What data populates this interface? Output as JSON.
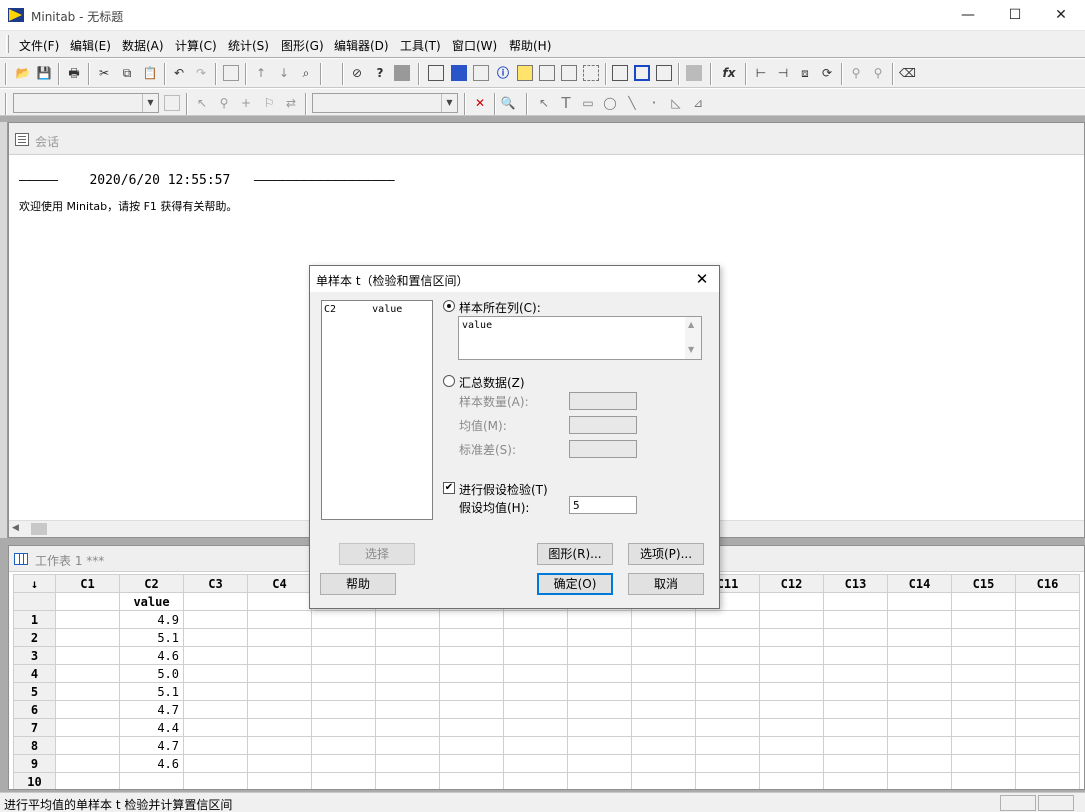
{
  "app": {
    "title": "Minitab - 无标题"
  },
  "window_controls": {
    "minimize": "—",
    "maximize": "☐",
    "close": "✕"
  },
  "menu": [
    "文件(F)",
    "编辑(E)",
    "数据(A)",
    "计算(C)",
    "统计(S)",
    "图形(G)",
    "编辑器(D)",
    "工具(T)",
    "窗口(W)",
    "帮助(H)"
  ],
  "toolbar_glyphs": {
    "open": "📂",
    "save": "💾",
    "print": "🖶",
    "cut": "✂",
    "copy": "⧉",
    "paste": "📋",
    "undo": "↶",
    "redo": "↷",
    "up": "↑",
    "down": "↓",
    "find": "⌕",
    "cancel": "⊘",
    "help": "?",
    "fx": "fx",
    "eraser": "⌫",
    "pointer": "↖",
    "text": "T",
    "crosshair": "+",
    "flag": "⚐",
    "swap": "⇄",
    "x": "✕",
    "zoom": "🔍",
    "line": "╲",
    "dot": "·",
    "rect": "▭",
    "ellipse": "◯"
  },
  "session": {
    "title": "会话",
    "line1_left": "—————",
    "timestamp": "2020/6/20 12:55:57",
    "line1_right": "——————————————————",
    "welcome": "欢迎使用 Minitab，请按 F1 获得有关帮助。"
  },
  "worksheet": {
    "title": "工作表 1 ***",
    "corner": "↓",
    "columns": [
      "C1",
      "C2",
      "C3",
      "C4",
      "",
      "",
      "",
      "",
      "",
      "",
      "C11",
      "C12",
      "C13",
      "C14",
      "C15",
      "C16"
    ],
    "col_names": [
      "",
      "value",
      "",
      "",
      "",
      "",
      "",
      "",
      "",
      "",
      "",
      "",
      "",
      "",
      "",
      ""
    ],
    "row_numbers": [
      "1",
      "2",
      "3",
      "4",
      "5",
      "6",
      "7",
      "8",
      "9",
      "10"
    ],
    "c2_values": [
      "4.9",
      "5.1",
      "4.6",
      "5.0",
      "5.1",
      "4.7",
      "4.4",
      "4.7",
      "4.6",
      ""
    ]
  },
  "statusbar": {
    "text": "进行平均值的单样本 t 检验并计算置信区间"
  },
  "dialog": {
    "title": "单样本 t（检验和置信区间）",
    "close": "✕",
    "list_item": "C2      value",
    "radio_columns_label": "样本所在列(C):",
    "columns_value": "value",
    "radio_summary_label": "汇总数据(Z)",
    "sample_size_label": "样本数量(A):",
    "mean_label": "均值(M):",
    "std_label": "标准差(S):",
    "hypothesis_check_label": "进行假设检验(T)",
    "hypothesis_checked": "✔",
    "hyp_mean_label": "假设均值(H):",
    "hyp_mean_value": "5",
    "buttons": {
      "select": "选择",
      "graphs": "图形(R)...",
      "options": "选项(P)...",
      "help": "帮助",
      "ok": "确定(O)",
      "cancel": "取消"
    }
  }
}
